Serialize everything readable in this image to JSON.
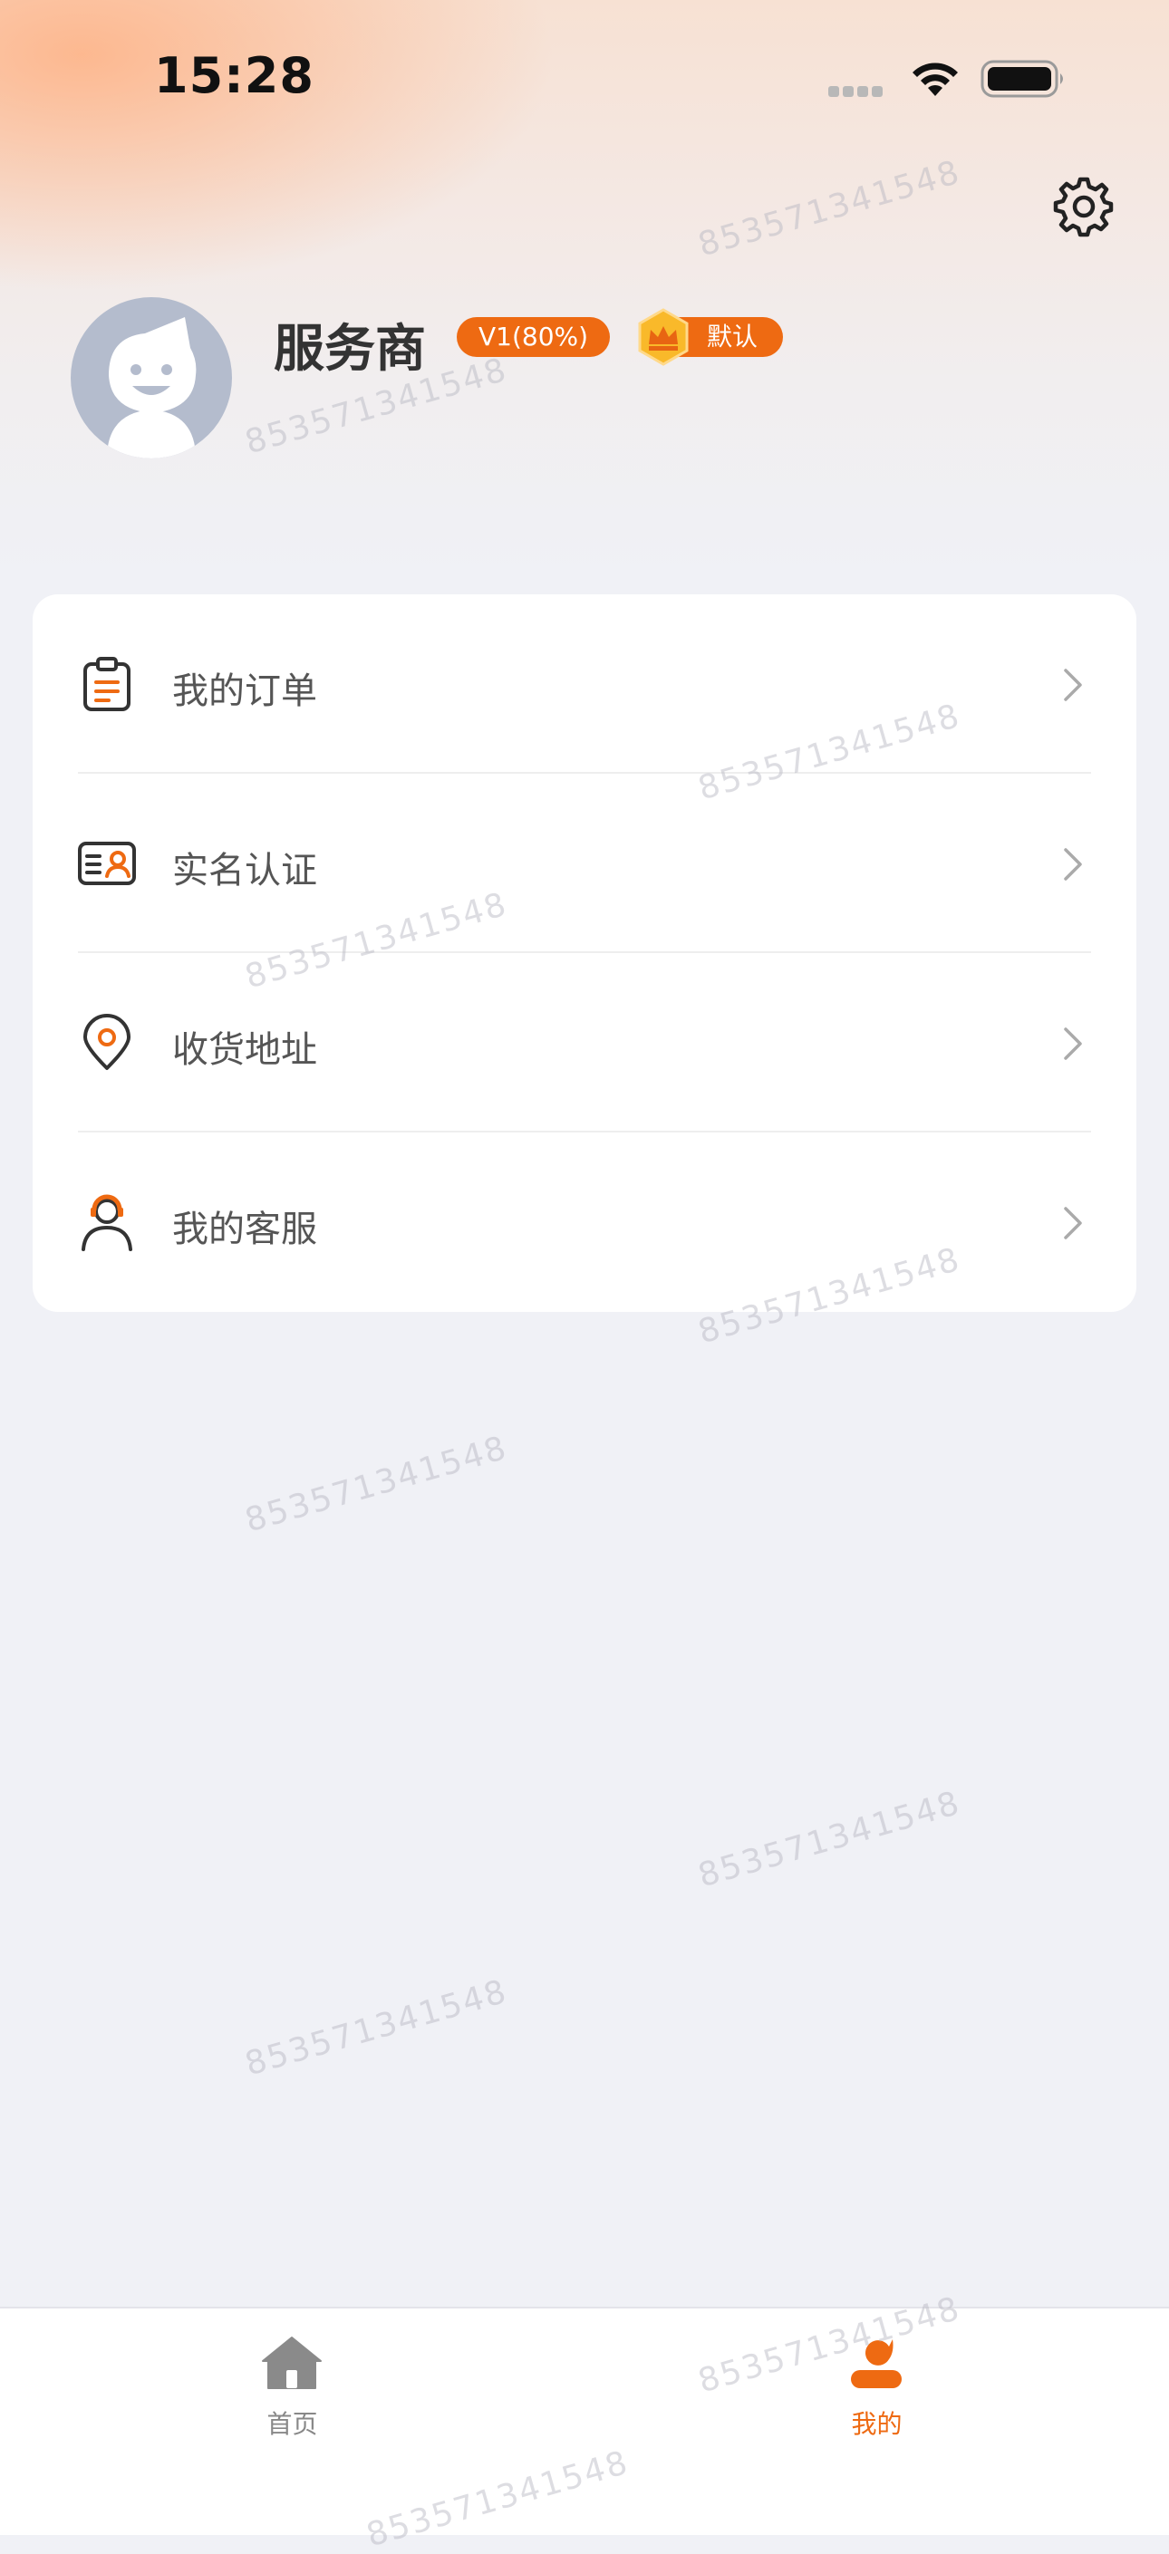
{
  "status_bar": {
    "time": "15:28"
  },
  "profile": {
    "name": "服务商",
    "level": "V1(80%)",
    "role": "默认"
  },
  "menu": {
    "items": [
      {
        "label": "我的订单",
        "icon": "clipboard-icon"
      },
      {
        "label": "实名认证",
        "icon": "id-card-icon"
      },
      {
        "label": "收货地址",
        "icon": "location-pin-icon"
      },
      {
        "label": "我的客服",
        "icon": "customer-service-icon"
      }
    ]
  },
  "tab_bar": {
    "tabs": [
      {
        "label": "首页",
        "icon": "home-icon",
        "active": false
      },
      {
        "label": "我的",
        "icon": "user-icon",
        "active": true
      }
    ]
  },
  "watermark": "853571341548",
  "colors": {
    "accent": "#ee6a12",
    "background": "#f0f1f6",
    "card": "#ffffff",
    "inactive_tab": "#999999"
  }
}
